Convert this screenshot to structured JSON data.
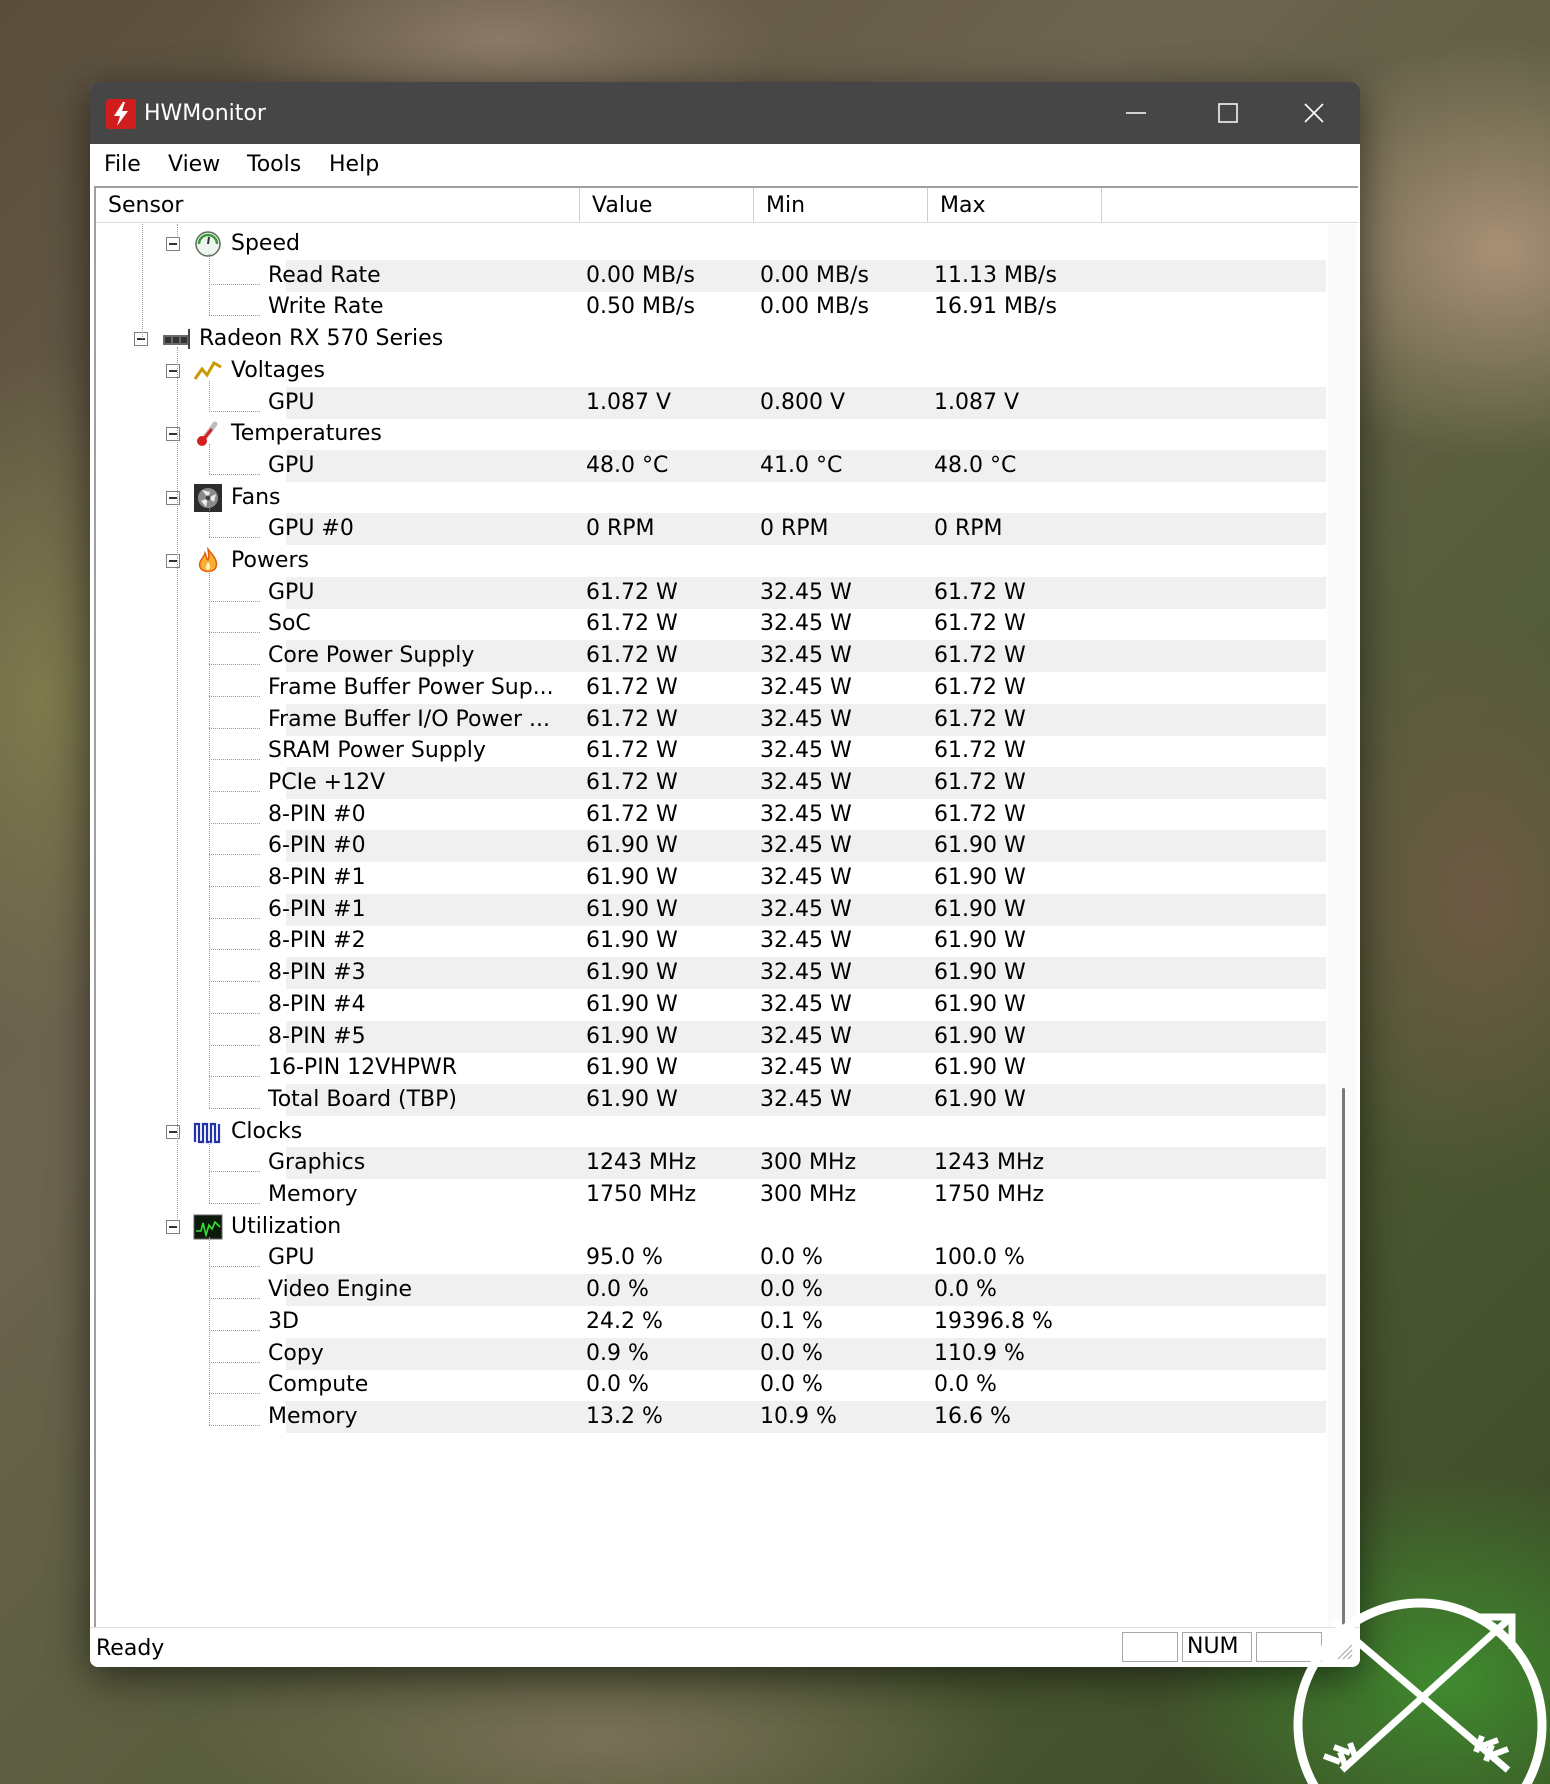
{
  "window": {
    "title": "HWMonitor"
  },
  "menu": [
    "File",
    "View",
    "Tools",
    "Help"
  ],
  "columns": [
    "Sensor",
    "Value",
    "Min",
    "Max"
  ],
  "tree": [
    {
      "kind": "group",
      "label": "Speed",
      "icon": "speedometer-icon"
    },
    {
      "kind": "leaf",
      "label": "Read Rate",
      "value": "0.00 MB/s",
      "min": "0.00 MB/s",
      "max": "11.13 MB/s"
    },
    {
      "kind": "leaf",
      "label": "Write Rate",
      "value": "0.50 MB/s",
      "min": "0.00 MB/s",
      "max": "16.91 MB/s"
    },
    {
      "kind": "device",
      "label": "Radeon RX 570 Series",
      "icon": "graphics-card-icon"
    },
    {
      "kind": "group",
      "label": "Voltages",
      "icon": "voltage-icon"
    },
    {
      "kind": "leaf",
      "label": "GPU",
      "value": "1.087 V",
      "min": "0.800 V",
      "max": "1.087 V"
    },
    {
      "kind": "group",
      "label": "Temperatures",
      "icon": "thermometer-icon"
    },
    {
      "kind": "leaf",
      "label": "GPU",
      "value": "48.0 °C",
      "min": "41.0 °C",
      "max": "48.0 °C"
    },
    {
      "kind": "group",
      "label": "Fans",
      "icon": "fan-icon"
    },
    {
      "kind": "leaf",
      "label": "GPU #0",
      "value": "0 RPM",
      "min": "0 RPM",
      "max": "0 RPM"
    },
    {
      "kind": "group",
      "label": "Powers",
      "icon": "flame-icon"
    },
    {
      "kind": "leaf",
      "label": "GPU",
      "value": "61.72 W",
      "min": "32.45 W",
      "max": "61.72 W"
    },
    {
      "kind": "leaf",
      "label": "SoC",
      "value": "61.72 W",
      "min": "32.45 W",
      "max": "61.72 W"
    },
    {
      "kind": "leaf",
      "label": "Core Power Supply",
      "value": "61.72 W",
      "min": "32.45 W",
      "max": "61.72 W"
    },
    {
      "kind": "leaf",
      "label": "Frame Buffer Power Sup...",
      "value": "61.72 W",
      "min": "32.45 W",
      "max": "61.72 W"
    },
    {
      "kind": "leaf",
      "label": "Frame Buffer I/O Power ...",
      "value": "61.72 W",
      "min": "32.45 W",
      "max": "61.72 W"
    },
    {
      "kind": "leaf",
      "label": "SRAM Power Supply",
      "value": "61.72 W",
      "min": "32.45 W",
      "max": "61.72 W"
    },
    {
      "kind": "leaf",
      "label": "PCIe +12V",
      "value": "61.72 W",
      "min": "32.45 W",
      "max": "61.72 W"
    },
    {
      "kind": "leaf",
      "label": "8-PIN #0",
      "value": "61.72 W",
      "min": "32.45 W",
      "max": "61.72 W"
    },
    {
      "kind": "leaf",
      "label": "6-PIN #0",
      "value": "61.90 W",
      "min": "32.45 W",
      "max": "61.90 W"
    },
    {
      "kind": "leaf",
      "label": "8-PIN #1",
      "value": "61.90 W",
      "min": "32.45 W",
      "max": "61.90 W"
    },
    {
      "kind": "leaf",
      "label": "6-PIN #1",
      "value": "61.90 W",
      "min": "32.45 W",
      "max": "61.90 W"
    },
    {
      "kind": "leaf",
      "label": "8-PIN #2",
      "value": "61.90 W",
      "min": "32.45 W",
      "max": "61.90 W"
    },
    {
      "kind": "leaf",
      "label": "8-PIN #3",
      "value": "61.90 W",
      "min": "32.45 W",
      "max": "61.90 W"
    },
    {
      "kind": "leaf",
      "label": "8-PIN #4",
      "value": "61.90 W",
      "min": "32.45 W",
      "max": "61.90 W"
    },
    {
      "kind": "leaf",
      "label": "8-PIN #5",
      "value": "61.90 W",
      "min": "32.45 W",
      "max": "61.90 W"
    },
    {
      "kind": "leaf",
      "label": "16-PIN 12VHPWR",
      "value": "61.90 W",
      "min": "32.45 W",
      "max": "61.90 W"
    },
    {
      "kind": "leaf",
      "label": "Total Board (TBP)",
      "value": "61.90 W",
      "min": "32.45 W",
      "max": "61.90 W"
    },
    {
      "kind": "group",
      "label": "Clocks",
      "icon": "clock-signal-icon"
    },
    {
      "kind": "leaf",
      "label": "Graphics",
      "value": "1243 MHz",
      "min": "300 MHz",
      "max": "1243 MHz"
    },
    {
      "kind": "leaf",
      "label": "Memory",
      "value": "1750 MHz",
      "min": "300 MHz",
      "max": "1750 MHz"
    },
    {
      "kind": "group",
      "label": "Utilization",
      "icon": "activity-monitor-icon"
    },
    {
      "kind": "leaf",
      "label": "GPU",
      "value": "95.0 %",
      "min": "0.0 %",
      "max": "100.0 %"
    },
    {
      "kind": "leaf",
      "label": "Video Engine",
      "value": "0.0 %",
      "min": "0.0 %",
      "max": "0.0 %"
    },
    {
      "kind": "leaf",
      "label": "3D",
      "value": "24.2 %",
      "min": "0.1 %",
      "max": "19396.8 %"
    },
    {
      "kind": "leaf",
      "label": "Copy",
      "value": "0.9 %",
      "min": "0.0 %",
      "max": "110.9 %"
    },
    {
      "kind": "leaf",
      "label": "Compute",
      "value": "0.0 %",
      "min": "0.0 %",
      "max": "0.0 %"
    },
    {
      "kind": "leaf",
      "label": "Memory",
      "value": "13.2 %",
      "min": "10.9 %",
      "max": "16.6 %"
    }
  ],
  "status": {
    "text": "Ready",
    "num": "NUM"
  },
  "watermark": {
    "letters": "JK"
  }
}
